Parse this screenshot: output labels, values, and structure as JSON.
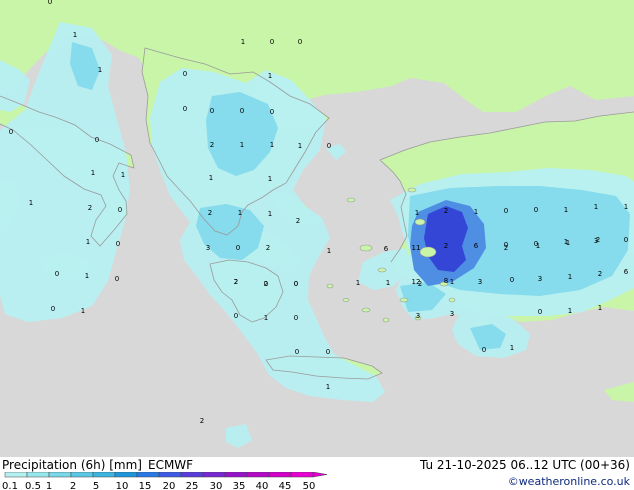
{
  "product": {
    "title": "Precipitation (6h) [mm] ECMWF",
    "title_parts": {
      "parameter": "Precipitation (6h) [mm]",
      "model": "ECMWF"
    },
    "valid": "Tu 21-10-2025 06..12 UTC (00+36)",
    "credit": "©weatheronline.co.uk"
  },
  "legend": {
    "labels": [
      "0.1",
      "0.5",
      "1",
      "2",
      "5",
      "10",
      "15",
      "20",
      "25",
      "30",
      "35",
      "40",
      "45",
      "50"
    ],
    "colors": [
      "#b4f0f0",
      "#96e6ec",
      "#78d7e8",
      "#5ac8e4",
      "#3cb4e0",
      "#1e96dc",
      "#2878e6",
      "#3c5ae6",
      "#5a3cdc",
      "#7828d2",
      "#9614c8",
      "#b40ac8",
      "#d200c8",
      "#e600d2"
    ]
  },
  "map_values": [
    "0",
    "1",
    "1",
    "0",
    "1",
    "0",
    "0",
    "0",
    "0",
    "1",
    "0",
    "0",
    "2",
    "1",
    "1",
    "1",
    "0",
    "0",
    "0",
    "1",
    "1",
    "1",
    "2",
    "0",
    "1",
    "1",
    "2",
    "1",
    "1",
    "2",
    "1",
    "0",
    "0",
    "2",
    "3",
    "1",
    "0",
    "1",
    "0",
    "2",
    "0",
    "0",
    "0",
    "1",
    "0",
    "1",
    "0",
    "0",
    "0",
    "1",
    "1",
    "1",
    "1",
    "2",
    "1",
    "0",
    "0",
    "1",
    "1",
    "1",
    "11",
    "2",
    "6",
    "0",
    "0",
    "1",
    "3",
    "0",
    "8",
    "12",
    "6",
    "2",
    "1",
    "3",
    "0",
    "3",
    "1",
    "2",
    "6",
    "2",
    "1",
    "1",
    "2",
    "3",
    "3",
    "0",
    "1",
    "0",
    "1",
    "1",
    "2",
    "2",
    "2",
    "0",
    "1"
  ],
  "colors": {
    "land": "#c9f5a8",
    "sea": "#d8d8d8",
    "coast": "#9a9a9a",
    "light_precip": "#b8f0f3",
    "medium_precip": "#86dbec",
    "heavy_precip": "#4f8fe3",
    "core_precip": "#3346d6"
  }
}
